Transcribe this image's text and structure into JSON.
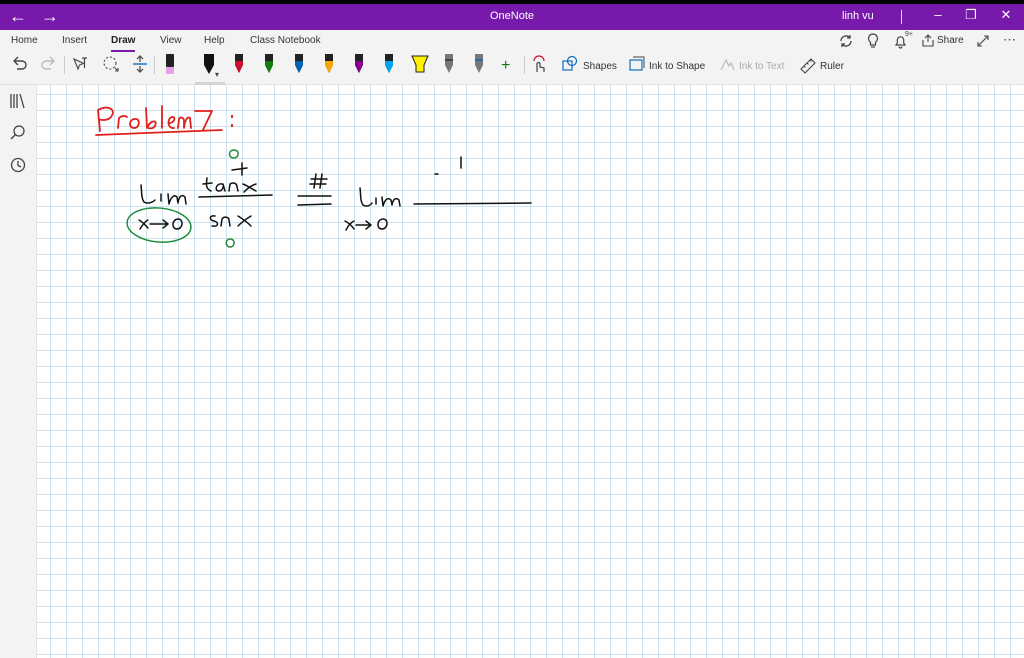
{
  "window": {
    "title": "OneNote",
    "user": "linh vu",
    "back_icon": "arrow-left-icon",
    "forward_icon": "arrow-right-icon"
  },
  "ribbon": {
    "tabs": [
      {
        "label": "Home"
      },
      {
        "label": "Insert"
      },
      {
        "label": "Draw",
        "active": true
      },
      {
        "label": "View"
      },
      {
        "label": "Help"
      },
      {
        "label": "Class Notebook"
      }
    ],
    "share_label": "Share",
    "notification_count": "9+",
    "shapes_label": "Shapes",
    "ink_to_shape_label": "Ink to Shape",
    "ink_to_text_label": "Ink to Text",
    "ruler_label": "Ruler",
    "pen_colors": [
      "#e6a0e6",
      "#000000",
      "#c8102e",
      "#107c10",
      "#0063b1",
      "#f7a800",
      "#8b008b",
      "#00a4ef",
      "#fff100",
      "#222222",
      "#0f6cbd"
    ],
    "accent": "#7719aa"
  },
  "page": {
    "heading_ink": "Problem 7 :",
    "heading_color": "#e0201c",
    "ink_color": "#000000",
    "annotation_color": "#1e8c3a",
    "equation_parts": [
      "lim",
      "x→0",
      "tan⁻¹x",
      "sin x",
      "0",
      "0",
      "#",
      "lim",
      "x→0",
      "1"
    ]
  }
}
